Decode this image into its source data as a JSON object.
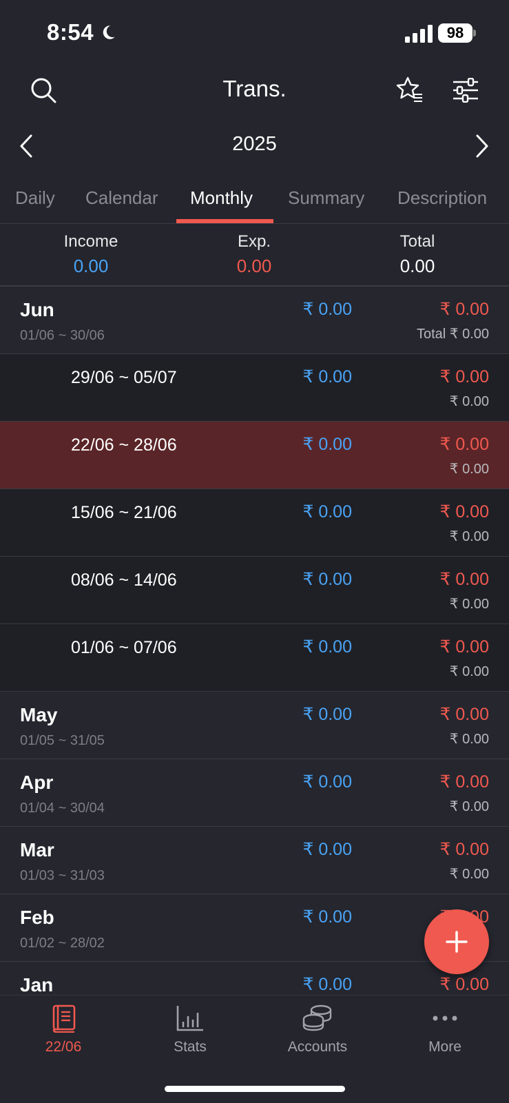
{
  "status": {
    "time": "8:54",
    "battery": "98"
  },
  "header": {
    "title": "Trans.",
    "year": "2025"
  },
  "tabs": [
    {
      "label": "Daily"
    },
    {
      "label": "Calendar"
    },
    {
      "label": "Monthly"
    },
    {
      "label": "Summary"
    },
    {
      "label": "Description"
    }
  ],
  "summary": {
    "income_label": "Income",
    "income_value": "0.00",
    "exp_label": "Exp.",
    "exp_value": "0.00",
    "total_label": "Total",
    "total_value": "0.00"
  },
  "rows": [
    {
      "kind": "month",
      "name": "Jun",
      "range": "01/06 ~ 30/06",
      "income": "₹ 0.00",
      "expense": "₹ 0.00",
      "total": "Total ₹ 0.00"
    },
    {
      "kind": "week",
      "range": "29/06 ~ 05/07",
      "income": "₹ 0.00",
      "expense": "₹ 0.00",
      "total": "₹ 0.00"
    },
    {
      "kind": "week",
      "range": "22/06 ~ 28/06",
      "income": "₹ 0.00",
      "expense": "₹ 0.00",
      "total": "₹ 0.00",
      "highlight": true
    },
    {
      "kind": "week",
      "range": "15/06 ~ 21/06",
      "income": "₹ 0.00",
      "expense": "₹ 0.00",
      "total": "₹ 0.00"
    },
    {
      "kind": "week",
      "range": "08/06 ~ 14/06",
      "income": "₹ 0.00",
      "expense": "₹ 0.00",
      "total": "₹ 0.00"
    },
    {
      "kind": "week",
      "range": "01/06 ~ 07/06",
      "income": "₹ 0.00",
      "expense": "₹ 0.00",
      "total": "₹ 0.00"
    },
    {
      "kind": "month",
      "name": "May",
      "range": "01/05 ~ 31/05",
      "income": "₹ 0.00",
      "expense": "₹ 0.00",
      "total": "₹ 0.00"
    },
    {
      "kind": "month",
      "name": "Apr",
      "range": "01/04 ~ 30/04",
      "income": "₹ 0.00",
      "expense": "₹ 0.00",
      "total": "₹ 0.00"
    },
    {
      "kind": "month",
      "name": "Mar",
      "range": "01/03 ~ 31/03",
      "income": "₹ 0.00",
      "expense": "₹ 0.00",
      "total": "₹ 0.00"
    },
    {
      "kind": "month",
      "name": "Feb",
      "range": "01/02 ~ 28/02",
      "income": "₹ 0.00",
      "expense": "₹ 0.00",
      "total": ""
    },
    {
      "kind": "month",
      "name": "Jan",
      "range": "",
      "income": "₹ 0.00",
      "expense": "₹ 0.00",
      "total": ""
    }
  ],
  "bottom_nav": [
    {
      "label": "22/06",
      "icon": "book-icon"
    },
    {
      "label": "Stats",
      "icon": "bar-chart-icon"
    },
    {
      "label": "Accounts",
      "icon": "coins-icon"
    },
    {
      "label": "More",
      "icon": "more-dots-icon"
    }
  ],
  "colors": {
    "accent": "#f0594f",
    "income": "#4aa3f5",
    "expense": "#f0594f",
    "background": "#24252d"
  }
}
